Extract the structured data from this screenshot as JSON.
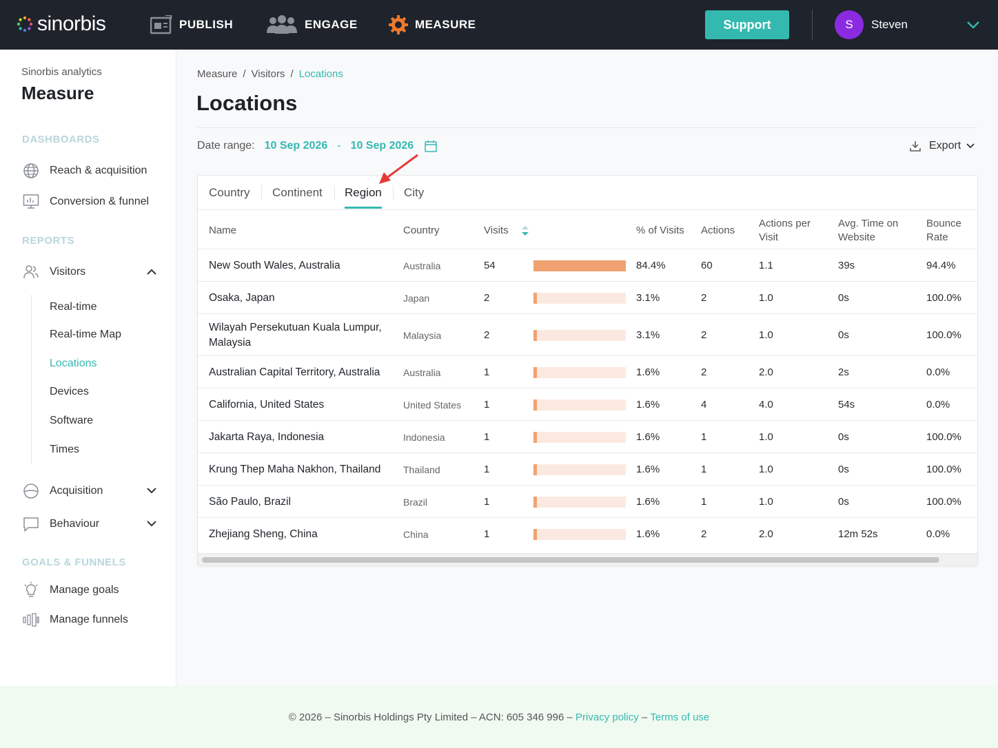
{
  "brand": {
    "name": "sinorbis"
  },
  "nav": {
    "publish": "PUBLISH",
    "engage": "ENGAGE",
    "measure": "MEASURE",
    "support": "Support",
    "user_initial": "S",
    "user_name": "Steven"
  },
  "sidebar": {
    "subtitle": "Sinorbis analytics",
    "title": "Measure",
    "dashboards_heading": "DASHBOARDS",
    "reach": "Reach & acquisition",
    "conversion": "Conversion & funnel",
    "reports_heading": "REPORTS",
    "visitors": "Visitors",
    "visitors_sub": [
      "Real-time",
      "Real-time Map",
      "Locations",
      "Devices",
      "Software",
      "Times"
    ],
    "acquisition": "Acquisition",
    "behaviour": "Behaviour",
    "goals_heading": "GOALS & FUNNELS",
    "manage_goals": "Manage goals",
    "manage_funnels": "Manage funnels"
  },
  "breadcrumb": [
    "Measure",
    "/",
    "Visitors",
    "/",
    "Locations"
  ],
  "page_title": "Locations",
  "date_range": {
    "label": "Date range:",
    "start": "10 Sep 2026",
    "sep": "-",
    "end": "10 Sep 2026"
  },
  "export_label": "Export",
  "tabs": [
    "Country",
    "Continent",
    "Region",
    "City"
  ],
  "active_tab": "Region",
  "table": {
    "headers": {
      "name": "Name",
      "country": "Country",
      "visits": "Visits",
      "pct": "% of Visits",
      "actions": "Actions",
      "apv_1": "Actions per",
      "apv_2": "Visit",
      "avg_1": "Avg. Time on",
      "avg_2": "Website",
      "bounce_1": "Bounce",
      "bounce_2": "Rate"
    },
    "rows": [
      {
        "name": "New South Wales, Australia",
        "country": "Australia",
        "visits": "54",
        "share": 1.0,
        "pct": "84.4%",
        "actions": "60",
        "apv": "1.1",
        "avg": "39s",
        "bounce": "94.4%"
      },
      {
        "name": "Osaka, Japan",
        "country": "Japan",
        "visits": "2",
        "share": 0.037,
        "pct": "3.1%",
        "actions": "2",
        "apv": "1.0",
        "avg": "0s",
        "bounce": "100.0%"
      },
      {
        "name": "Wilayah Persekutuan Kuala Lumpur, Malaysia",
        "country": "Malaysia",
        "visits": "2",
        "share": 0.037,
        "pct": "3.1%",
        "actions": "2",
        "apv": "1.0",
        "avg": "0s",
        "bounce": "100.0%"
      },
      {
        "name": "Australian Capital Territory, Australia",
        "country": "Australia",
        "visits": "1",
        "share": 0.019,
        "pct": "1.6%",
        "actions": "2",
        "apv": "2.0",
        "avg": "2s",
        "bounce": "0.0%"
      },
      {
        "name": "California, United States",
        "country": "United States",
        "visits": "1",
        "share": 0.019,
        "pct": "1.6%",
        "actions": "4",
        "apv": "4.0",
        "avg": "54s",
        "bounce": "0.0%"
      },
      {
        "name": "Jakarta Raya, Indonesia",
        "country": "Indonesia",
        "visits": "1",
        "share": 0.019,
        "pct": "1.6%",
        "actions": "1",
        "apv": "1.0",
        "avg": "0s",
        "bounce": "100.0%"
      },
      {
        "name": "Krung Thep Maha Nakhon, Thailand",
        "country": "Thailand",
        "visits": "1",
        "share": 0.019,
        "pct": "1.6%",
        "actions": "1",
        "apv": "1.0",
        "avg": "0s",
        "bounce": "100.0%"
      },
      {
        "name": "São Paulo, Brazil",
        "country": "Brazil",
        "visits": "1",
        "share": 0.019,
        "pct": "1.6%",
        "actions": "1",
        "apv": "1.0",
        "avg": "0s",
        "bounce": "100.0%"
      },
      {
        "name": "Zhejiang Sheng, China",
        "country": "China",
        "visits": "1",
        "share": 0.019,
        "pct": "1.6%",
        "actions": "2",
        "apv": "2.0",
        "avg": "12m 52s",
        "bounce": "0.0%"
      }
    ]
  },
  "footer": {
    "text": "© 2026 – Sinorbis Holdings Pty Limited – ACN: 605 346 996 –",
    "privacy": "Privacy policy",
    "dash": "–",
    "terms": "Terms of use"
  },
  "colors": {
    "accent": "#34b9b0",
    "bar": "#f0a270",
    "bar_track": "#fbe9e1",
    "topbar": "#1f232b",
    "avatar": "#8a2be2",
    "annotation_arrow": "#e53935"
  }
}
